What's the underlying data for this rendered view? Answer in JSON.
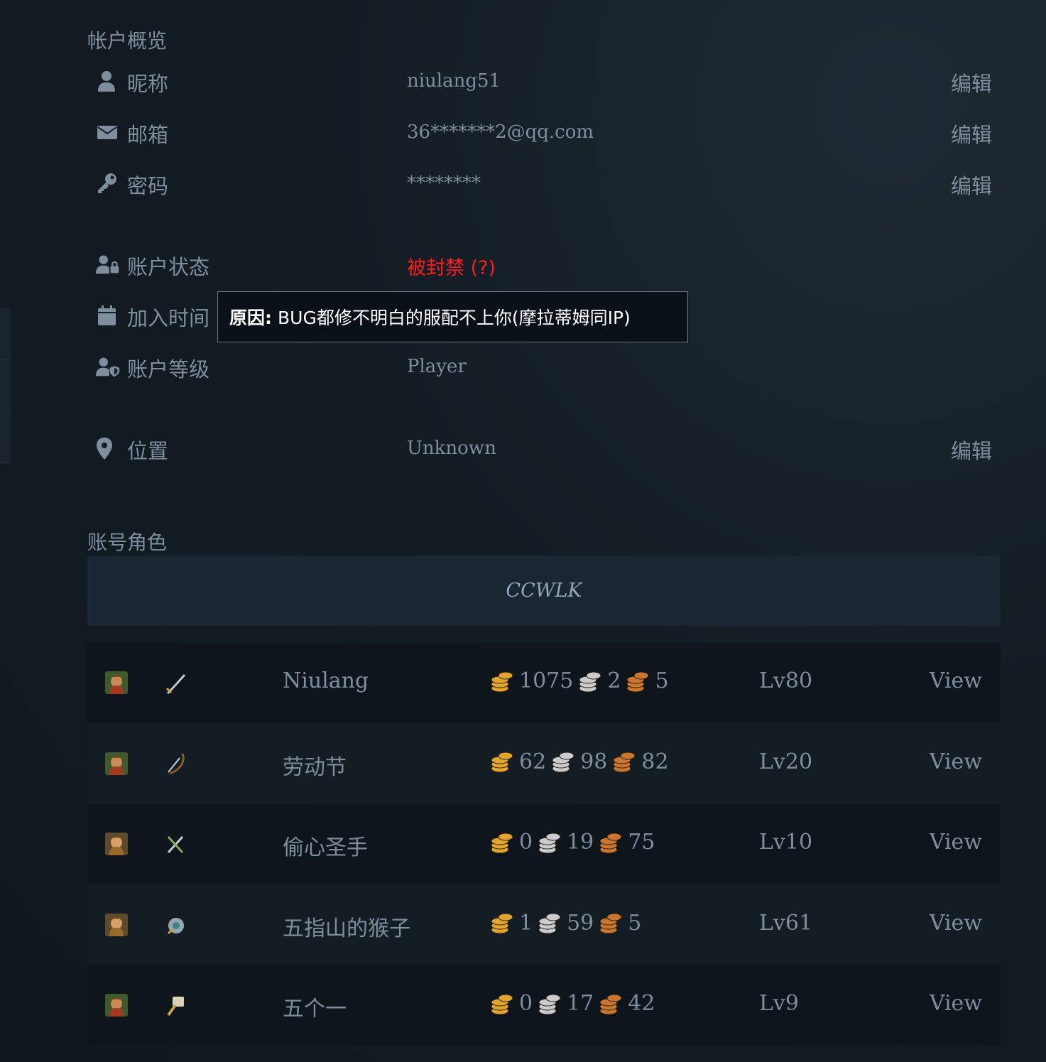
{
  "overview": {
    "title": "帐户概览",
    "rows": [
      {
        "key": "nickname",
        "icon": "user-icon",
        "label": "昵称",
        "value": "niulang51",
        "edit": "编辑"
      },
      {
        "key": "email",
        "icon": "envelope-icon",
        "label": "邮箱",
        "value": "36*******2@qq.com",
        "edit": "编辑"
      },
      {
        "key": "password",
        "icon": "key-icon",
        "label": "密码",
        "value": "********",
        "edit": "编辑"
      },
      {
        "key": "status",
        "icon": "user-lock-icon",
        "label": "账户状态",
        "value": "被封禁 (?)"
      },
      {
        "key": "joined",
        "icon": "calendar-icon",
        "label": "加入时间",
        "value": ""
      },
      {
        "key": "level",
        "icon": "user-shield-icon",
        "label": "账户等级",
        "value": "Player"
      },
      {
        "key": "location",
        "icon": "map-pin-icon",
        "label": "位置",
        "value": "Unknown",
        "edit": "编辑"
      }
    ]
  },
  "tooltip": {
    "label": "原因:",
    "text": "BUG都修不明白的服配不上你(摩拉蒂姆同IP)"
  },
  "characters": {
    "title": "账号角色",
    "realm": "CCWLK",
    "rows": [
      {
        "name": "Niulang",
        "gold": "1075",
        "silver": "2",
        "copper": "5",
        "level": "Lv80",
        "view": "View",
        "race_icon": "dwarf-male-icon",
        "class_icon": "warrior-icon"
      },
      {
        "name": "劳动节",
        "gold": "62",
        "silver": "98",
        "copper": "82",
        "level": "Lv20",
        "view": "View",
        "race_icon": "dwarf-male-icon",
        "class_icon": "hunter-icon"
      },
      {
        "name": "偷心圣手",
        "gold": "0",
        "silver": "19",
        "copper": "75",
        "level": "Lv10",
        "view": "View",
        "race_icon": "human-female-icon",
        "class_icon": "rogue-icon"
      },
      {
        "name": "五指山的猴子",
        "gold": "1",
        "silver": "59",
        "copper": "5",
        "level": "Lv61",
        "view": "View",
        "race_icon": "human-female-icon",
        "class_icon": "shaman-icon"
      },
      {
        "name": "五个一",
        "gold": "0",
        "silver": "17",
        "copper": "42",
        "level": "Lv9",
        "view": "View",
        "race_icon": "dwarf-male-icon",
        "class_icon": "paladin-icon"
      }
    ]
  },
  "colors": {
    "banned": "#ff1c1c",
    "gold_coin": "#e0a52a",
    "silver_coin": "#c9cbcf",
    "copper_coin": "#c9772f"
  }
}
